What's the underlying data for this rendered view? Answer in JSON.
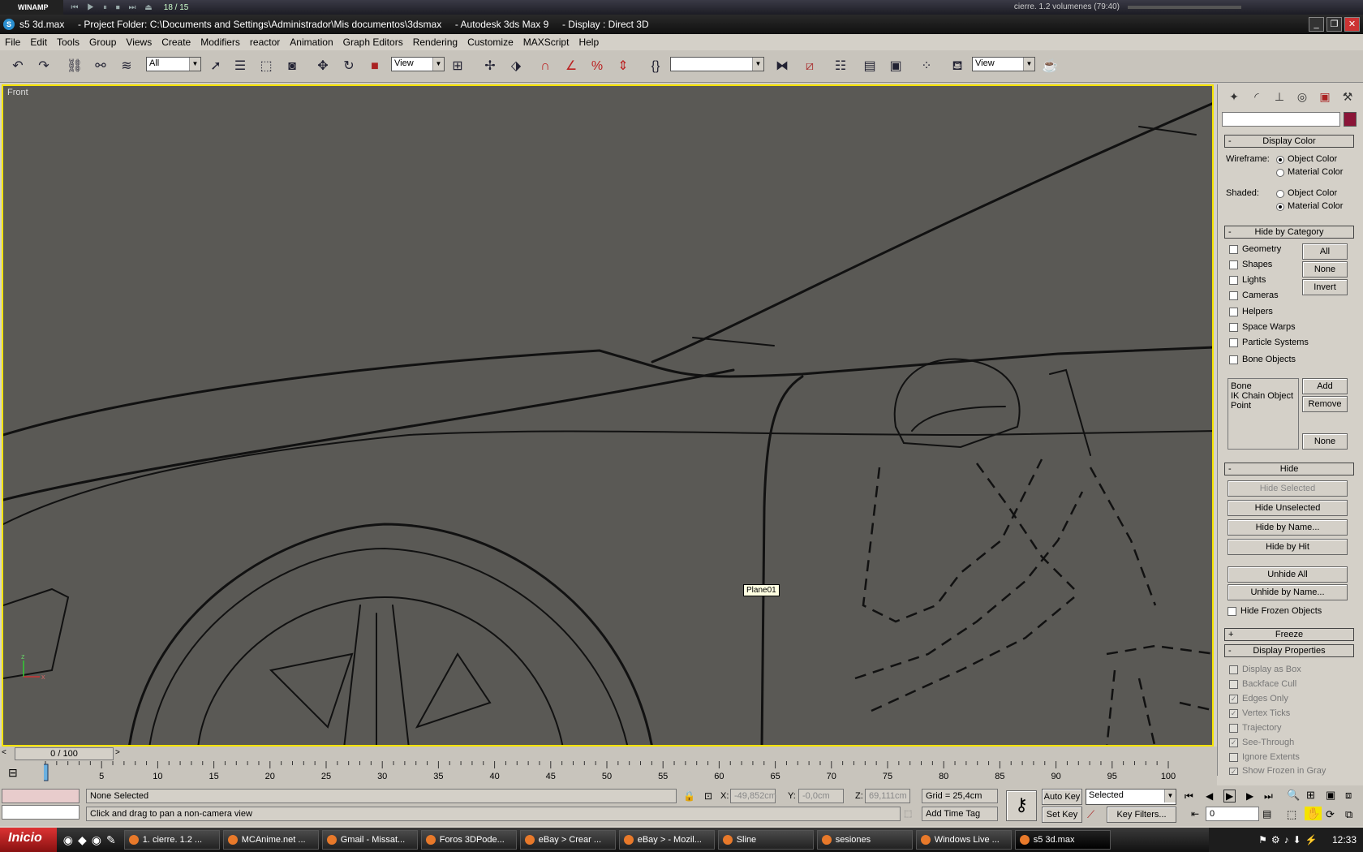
{
  "winamp": {
    "logo": "WINAMP",
    "time": "18 / 15",
    "track": "cierre. 1.2 volumenes (79:40)"
  },
  "window": {
    "title": "s5 3d.max     - Project Folder: C:\\Documents and Settings\\Administrador\\Mis documentos\\3dsmax     - Autodesk 3ds Max 9     - Display : Direct 3D"
  },
  "menu": [
    "File",
    "Edit",
    "Tools",
    "Group",
    "Views",
    "Create",
    "Modifiers",
    "reactor",
    "Animation",
    "Graph Editors",
    "Rendering",
    "Customize",
    "MAXScript",
    "Help"
  ],
  "toolbar": {
    "filter_value": "All",
    "refcoord_value": "View",
    "render_view_value": "View",
    "named_sel_value": ""
  },
  "viewport": {
    "label": "Front",
    "tooltip": "Plane01"
  },
  "panel": {
    "display_color": {
      "title": "Display Color",
      "wireframe_label": "Wireframe:",
      "shaded_label": "Shaded:",
      "object_color": "Object Color",
      "material_color": "Material Color"
    },
    "hide_by_category": {
      "title": "Hide by Category",
      "items": [
        "Geometry",
        "Shapes",
        "Lights",
        "Cameras",
        "Helpers",
        "Space Warps",
        "Particle Systems",
        "Bone Objects"
      ],
      "all": "All",
      "none": "None",
      "invert": "Invert",
      "list": [
        "Bone",
        "IK Chain Object",
        "Point"
      ],
      "add": "Add",
      "remove": "Remove",
      "none2": "None"
    },
    "hide": {
      "title": "Hide",
      "hide_selected": "Hide Selected",
      "hide_unselected": "Hide Unselected",
      "hide_by_name": "Hide by Name...",
      "hide_by_hit": "Hide by Hit",
      "unhide_all": "Unhide All",
      "unhide_by_name": "Unhide by Name...",
      "hide_frozen": "Hide Frozen Objects"
    },
    "freeze": {
      "title": "Freeze"
    },
    "display_props": {
      "title": "Display Properties",
      "items": [
        "Display as Box",
        "Backface Cull",
        "Edges Only",
        "Vertex Ticks",
        "Trajectory",
        "See-Through",
        "Ignore Extents",
        "Show Frozen in Gray"
      ]
    }
  },
  "timeline": {
    "slider": "0 / 100",
    "ticks": [
      "0",
      "5",
      "10",
      "15",
      "20",
      "25",
      "30",
      "35",
      "40",
      "45",
      "50",
      "55",
      "60",
      "65",
      "70",
      "75",
      "80",
      "85",
      "90",
      "95",
      "100"
    ]
  },
  "status": {
    "selection": "None Selected",
    "prompt": "Click and drag to pan a non-camera view",
    "x_label": "X:",
    "x": "-49,852cm",
    "y_label": "Y:",
    "y": "-0,0cm",
    "z_label": "Z:",
    "z": "69,111cm",
    "grid": "Grid = 25,4cm",
    "add_time_tag": "Add Time Tag",
    "auto_key": "Auto Key",
    "set_key": "Set Key",
    "selected": "Selected",
    "key_filters": "Key Filters...",
    "frame": "0"
  },
  "taskbar": {
    "start": "Inicio",
    "tasks": [
      "1. cierre. 1.2 ...",
      "MCAnime.net ...",
      "Gmail - Missat...",
      "Foros 3DPode...",
      "eBay > Crear ...",
      "eBay > - Mozil...",
      "Sline",
      "sesiones",
      "Windows Live ...",
      "s5 3d.max"
    ],
    "clock": "12:33"
  }
}
